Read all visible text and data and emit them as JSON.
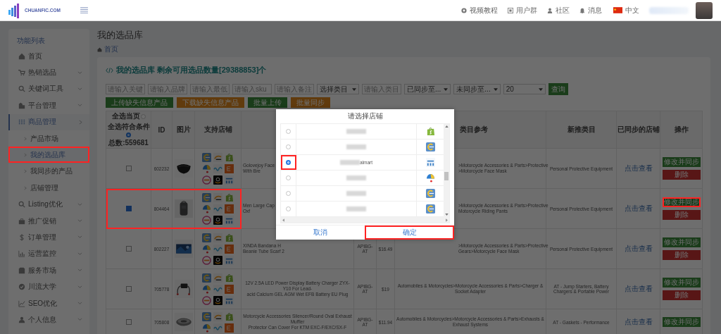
{
  "header": {
    "logo_text": "CHUANFIC.COM",
    "nav": [
      {
        "label": "视频教程"
      },
      {
        "label": "用户群"
      },
      {
        "label": "社区"
      },
      {
        "label": "消息"
      }
    ],
    "language": "中文"
  },
  "sidebar": {
    "title": "功能列表",
    "items": [
      {
        "label": "首页",
        "kind": "link",
        "selected": false
      },
      {
        "label": "热销选品",
        "kind": "menu",
        "selected": false,
        "expanded": false
      },
      {
        "label": "关键词工具",
        "kind": "menu",
        "selected": false,
        "expanded": false
      },
      {
        "label": "平台管理",
        "kind": "menu",
        "selected": false,
        "expanded": false
      },
      {
        "label": "商品管理",
        "kind": "menu",
        "selected": true,
        "expanded": true,
        "children": [
          {
            "label": "产品市场",
            "selected": false,
            "highlighted": false
          },
          {
            "label": "我的选品库",
            "selected": true,
            "highlighted": true
          },
          {
            "label": "我同步的产品",
            "selected": false,
            "highlighted": false
          },
          {
            "label": "店铺管理",
            "selected": false,
            "highlighted": false
          }
        ]
      },
      {
        "label": "Listing优化",
        "kind": "menu",
        "selected": false,
        "expanded": false
      },
      {
        "label": "推广促销",
        "kind": "menu",
        "selected": false,
        "expanded": false
      },
      {
        "label": "订单管理",
        "kind": "menu",
        "selected": false,
        "expanded": false
      },
      {
        "label": "运营监控",
        "kind": "menu",
        "selected": false,
        "expanded": false
      },
      {
        "label": "服务市场",
        "kind": "menu",
        "selected": false,
        "expanded": false
      },
      {
        "label": "川流大学",
        "kind": "menu",
        "selected": false,
        "expanded": false
      },
      {
        "label": "SEO优化",
        "kind": "menu",
        "selected": false,
        "expanded": false
      },
      {
        "label": "个人信息",
        "kind": "menu",
        "selected": false,
        "expanded": false
      }
    ]
  },
  "page": {
    "title": "我的选品库",
    "breadcrumb": "首页"
  },
  "card": {
    "heading": "我的选品库 剩余可用选品数量[29388853]个",
    "filters": [
      {
        "kind": "input",
        "placeholder": "请输入关键"
      },
      {
        "kind": "input",
        "placeholder": "请输入品牌"
      },
      {
        "kind": "input",
        "placeholder": "请输入最低"
      },
      {
        "kind": "input",
        "placeholder": "请输入sku"
      },
      {
        "kind": "input",
        "placeholder": "请输入备注"
      },
      {
        "kind": "select",
        "value": "选择类目"
      },
      {
        "kind": "input",
        "placeholder": "请输入类目"
      },
      {
        "kind": "select",
        "value": "已同步至..."
      },
      {
        "kind": "select",
        "value": "未同步至..."
      },
      {
        "kind": "select",
        "value": "20"
      }
    ],
    "query_button": "查询",
    "actions": [
      {
        "label": "上传缺失信息产品",
        "kind": "success"
      },
      {
        "label": "下载缺失信息产品",
        "kind": "warning"
      },
      {
        "label": "批量上传",
        "kind": "success"
      },
      {
        "label": "批量同步",
        "kind": "warning"
      }
    ]
  },
  "table": {
    "select_page": {
      "label": "全选当页",
      "selected": false
    },
    "select_all": {
      "label": "全选符合条件",
      "selected": true
    },
    "total": "总数:559681",
    "columns": {
      "id": "ID",
      "image": "图片",
      "stores": "支持店铺",
      "category": "类目参考",
      "new_category": "新推类目",
      "synced": "已同步的店铺",
      "actions": "操作"
    },
    "rows": [
      {
        "checked": false,
        "highlighted": false,
        "id": "602232",
        "title_lines": [
          "Golovejoy Face",
          "With Bre"
        ],
        "category_lines": [
          ">Motorcycle Accessories & Parts>Protective",
          ">Motorcycle Face Mask"
        ],
        "new_category": "Personal Protective Equipment",
        "synced": "点击查看",
        "edit": "修改并同步",
        "delete": "删除"
      },
      {
        "checked": true,
        "highlighted": true,
        "id": "804464",
        "title_lines": [
          "Men Large Cap",
          "Oxf"
        ],
        "category_lines": [
          ">Motorcycle Accessories & Parts>Protective",
          "Motorcycle Riding Pants"
        ],
        "new_category": "Personal Protective Equipment",
        "synced": "点击查看",
        "edit": "修改并同步",
        "delete": "删除"
      },
      {
        "checked": false,
        "highlighted": false,
        "id": "802227",
        "title_lines": [
          "XINDA Bandana H",
          "Beanie Tube Scarf 2"
        ],
        "sku": "APIBG-AT",
        "price": "$16.49",
        "category_lines": [
          ">Motorcycle Accessories & Parts>Protective",
          "Gears>Motorcycle Face Mask"
        ],
        "new_category": "Personal Protective Equipment",
        "synced": "点击查看",
        "edit": "修改并同步",
        "delete": "删除"
      },
      {
        "checked": false,
        "highlighted": false,
        "id": "705778",
        "title_lines": [
          "12V 2.5A LED Power Display Battery Charger ZYX-Y10 For Lead-",
          "acid Calcium GEL AGM Wet EFB Battery EU Plug"
        ],
        "sku": "APIBG-AT",
        "price": "$19",
        "category_lines": [
          "Automobiles & Motorcycles>Motorcycle Accessories & Parts>Charger & Socket Adapter"
        ],
        "new_category": "AT - Jump Starters, Battery Chargers & Portable Power",
        "synced": "点击查看",
        "edit": "修改并同步",
        "delete": "删除"
      },
      {
        "checked": false,
        "highlighted": false,
        "id": "705808",
        "title_lines": [
          "Motorcycle Accessories Silencer/Round Oval Exhaust Muffler",
          "Protector Can Cover For KTM EXC-F/EXC/SX-F"
        ],
        "sku": "APIBG-AT",
        "price": "$11.94",
        "category_lines": [
          "Automobiles & Motorcycles>Motorcycle Accessories & Parts>Exhausts & Exhaust Systems"
        ],
        "new_category": "AT - Gaskets - Performance",
        "synced": "点击查看",
        "edit": "修改并同步"
      }
    ]
  },
  "modal": {
    "title": "请选择店铺",
    "stores": [
      {
        "selected": false,
        "highlighted": false
      },
      {
        "selected": false,
        "highlighted": false
      },
      {
        "selected": true,
        "highlighted": true,
        "name": "almart"
      },
      {
        "selected": false,
        "highlighted": false
      },
      {
        "selected": false,
        "highlighted": false
      },
      {
        "selected": false,
        "highlighted": false
      }
    ],
    "cancel": "取消",
    "confirm": "确定",
    "confirm_highlighted": true
  }
}
